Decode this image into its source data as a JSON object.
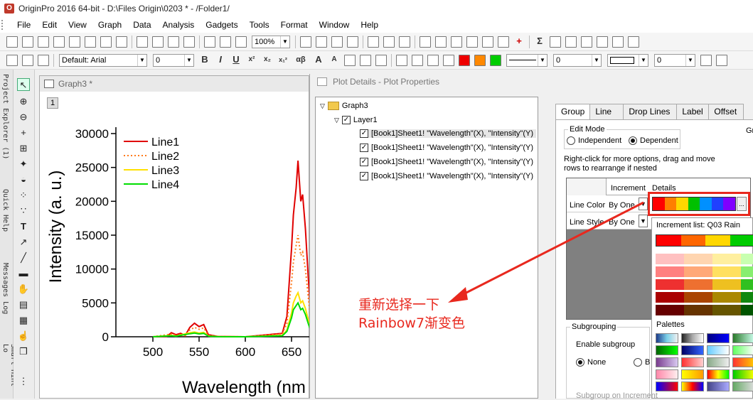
{
  "title_bar": {
    "text": "OriginPro 2016 64-bit - D:\\Files Origin\\0203 * - /Folder1/",
    "logo": "origin-logo-icon"
  },
  "menu": [
    "File",
    "Edit",
    "View",
    "Graph",
    "Data",
    "Analysis",
    "Gadgets",
    "Tools",
    "Format",
    "Window",
    "Help"
  ],
  "toolbar1": {
    "zoom": "100%"
  },
  "toolbar2": {
    "font_name": "Default: Arial",
    "font_size": "0",
    "line_width": "0",
    "size2": "0",
    "format_chars": [
      "B",
      "I",
      "U",
      "x²",
      "x₂",
      "x₁²",
      "αβ",
      "A",
      "A"
    ]
  },
  "left_dock_tabs": [
    "Project Explorer (1)",
    "Quick Help",
    "Messages Log",
    "Smart Hint Lo"
  ],
  "graph_window": {
    "title": "Graph3 *",
    "page_number": "1"
  },
  "chart_data": {
    "type": "line",
    "xlabel": "Wavelength (nm",
    "ylabel": "Intensity (a. u.)",
    "xticks": [
      "500",
      "550",
      "600",
      "650"
    ],
    "yticks": [
      "0",
      "5000",
      "10000",
      "15000",
      "20000",
      "25000",
      "30000"
    ],
    "xlim": [
      460,
      670
    ],
    "ylim": [
      -2000,
      31000
    ],
    "series": [
      {
        "name": "Line1",
        "color": "#e00000",
        "style": "solid",
        "x": [
          500,
          515,
          520,
          525,
          530,
          535,
          540,
          545,
          550,
          555,
          560,
          570,
          600,
          640,
          645,
          650,
          652,
          655,
          657,
          660,
          662,
          665,
          668,
          670
        ],
        "y": [
          0,
          50,
          600,
          300,
          500,
          200,
          1400,
          2000,
          1500,
          1800,
          300,
          50,
          0,
          500,
          3000,
          13000,
          18000,
          22000,
          26000,
          20000,
          21000,
          16000,
          9000,
          5000
        ]
      },
      {
        "name": "Line2",
        "color": "#ff7a1a",
        "style": "dotted",
        "x": [
          500,
          520,
          525,
          535,
          540,
          545,
          550,
          555,
          560,
          570,
          600,
          640,
          645,
          650,
          652,
          655,
          657,
          660,
          662,
          665,
          668,
          670
        ],
        "y": [
          0,
          400,
          200,
          150,
          1000,
          1400,
          1100,
          1300,
          200,
          40,
          0,
          400,
          2000,
          8000,
          11000,
          13500,
          15000,
          12000,
          12500,
          10000,
          6000,
          3500
        ]
      },
      {
        "name": "Line3",
        "color": "#ffe000",
        "style": "solid",
        "x": [
          500,
          520,
          525,
          540,
          545,
          550,
          555,
          560,
          570,
          600,
          640,
          645,
          650,
          652,
          655,
          657,
          660,
          662,
          665,
          668,
          670
        ],
        "y": [
          0,
          200,
          100,
          600,
          700,
          550,
          650,
          100,
          20,
          0,
          200,
          1000,
          3500,
          5000,
          6000,
          6500,
          5000,
          5300,
          4200,
          2600,
          1600
        ]
      },
      {
        "name": "Line4",
        "color": "#00dd00",
        "style": "solid",
        "x": [
          500,
          520,
          525,
          540,
          545,
          550,
          555,
          560,
          570,
          600,
          640,
          645,
          650,
          652,
          655,
          657,
          660,
          662,
          665,
          668,
          670
        ],
        "y": [
          0,
          150,
          80,
          450,
          550,
          420,
          500,
          80,
          15,
          0,
          150,
          800,
          2800,
          4000,
          4600,
          5000,
          4000,
          4200,
          3300,
          2000,
          1200
        ]
      }
    ],
    "legend": "top-left"
  },
  "plot_details": {
    "title": "Plot Details - Plot Properties",
    "tree": {
      "root": "Graph3",
      "layer": "Layer1",
      "plots": [
        "[Book1]Sheet1! \"Wavelength\"(X), \"Intensity\"(Y)",
        "[Book1]Sheet1! \"Wavelength\"(X), \"Intensity\"(Y)",
        "[Book1]Sheet1! \"Wavelength\"(X), \"Intensity\"(Y)",
        "[Book1]Sheet1! \"Wavelength\"(X), \"Intensity\"(Y)"
      ]
    },
    "tabs": [
      "Group",
      "Line",
      "Drop Lines",
      "Label",
      "Offset"
    ],
    "edit_mode_label": "Edit Mode",
    "independent": "Independent",
    "dependent": "Dependent",
    "hint": "Right-click for more options, drag and move rows to  rearrange if nested",
    "grid_headers": [
      "Increment",
      "Details"
    ],
    "rows": [
      {
        "label": "Line Color",
        "value": "By One"
      },
      {
        "label": "Line Style",
        "value": "By One"
      }
    ],
    "increment_list_label": "Increment list: Q03 Rain",
    "palettes_label": "Palettes",
    "subgrouping_label": "Subgrouping",
    "enable_subgroup": "Enable subgroup",
    "none_label": "None",
    "b_label": "B",
    "subgroup_increment": "Subgroup on Increment",
    "ellipsis": "...",
    "gr_cut": "Gr"
  },
  "annotation": {
    "line1": "重新选择一下",
    "line2": "Rainbow7渐变色",
    "color": "#e8281e"
  }
}
